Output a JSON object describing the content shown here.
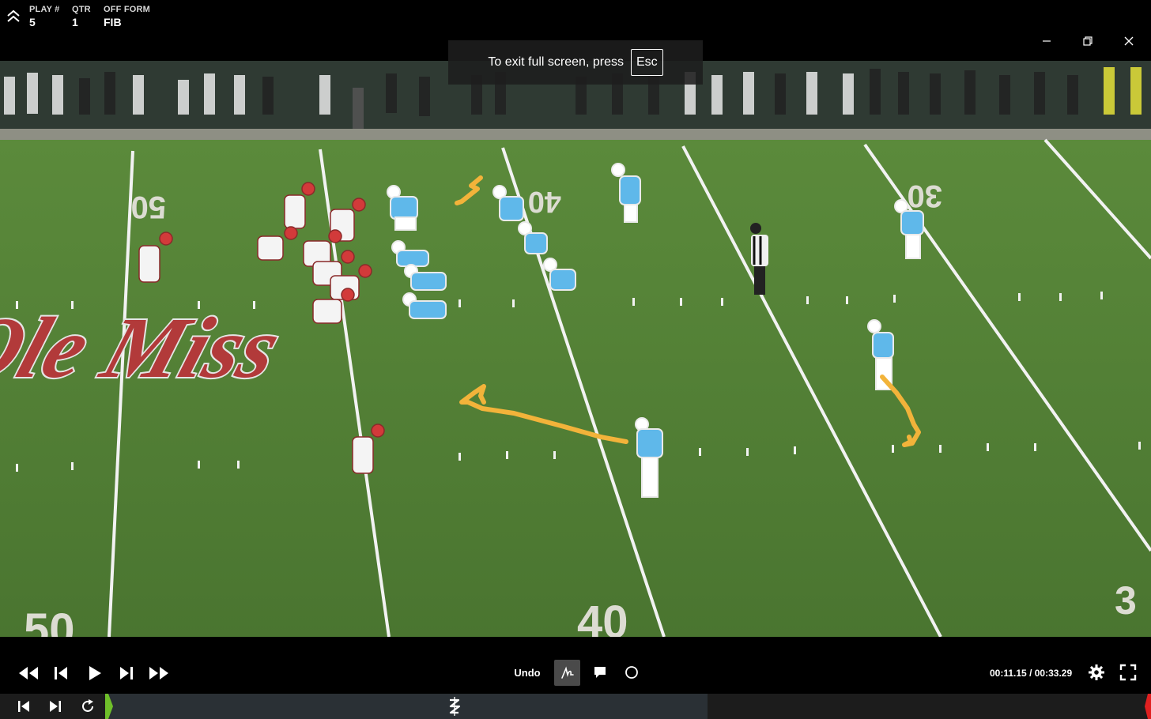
{
  "play_info": {
    "play_label": "PLAY #",
    "play_value": "5",
    "qtr_label": "QTR",
    "qtr_value": "1",
    "form_label": "OFF FORM",
    "form_value": "FIB"
  },
  "toast": {
    "text": "To exit full screen, press",
    "key": "Esc"
  },
  "field": {
    "yard_numbers": [
      "50",
      "40",
      "40",
      "30",
      "3"
    ],
    "logo_text": "Ole Miss"
  },
  "controls": {
    "undo_label": "Undo",
    "time_current": "00:11.15",
    "time_separator": "/",
    "time_total": "00:33.29"
  },
  "colors": {
    "field_green": "#4d7a32",
    "annotation": "#f2b33a",
    "home_jersey": "#5fb8ea",
    "away_jersey": "#f2f2f2",
    "timeline_start": "#6fbf2a",
    "timeline_end": "#e02020"
  },
  "icons": {
    "collapse": "chevron-up-double-icon",
    "minimize": "minimize-icon",
    "restore": "restore-icon",
    "close": "close-icon",
    "rewind": "rewind-icon",
    "step_back": "step-back-icon",
    "play": "play-icon",
    "step_forward": "step-forward-icon",
    "fast_forward": "fast-forward-icon",
    "draw": "draw-icon",
    "comment": "comment-icon",
    "circle": "circle-icon",
    "settings": "gear-icon",
    "fullscreen": "fullscreen-icon",
    "skip_start": "skip-start-icon",
    "skip_end": "skip-end-icon",
    "replay": "replay-icon",
    "marker": "marker-icon"
  }
}
